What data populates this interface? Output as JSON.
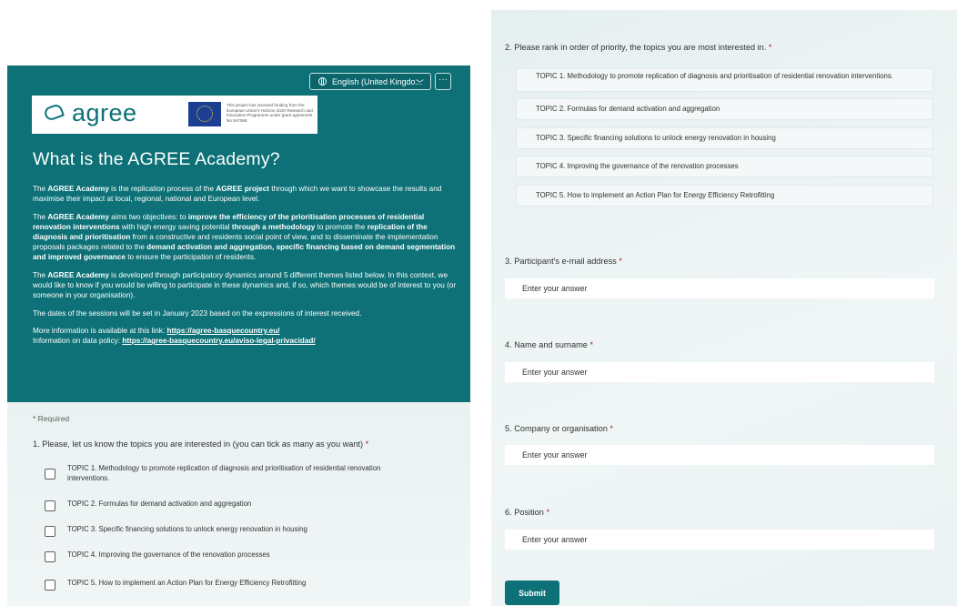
{
  "header": {
    "language_button": "English (United Kingdo...",
    "more_button": "···"
  },
  "logo": {
    "brand": "agree",
    "eu_funding_text": "This project has received funding from the European Union's Horizon 2020 Research and Innovation Programme under grant agreement No 847068."
  },
  "banner": {
    "title": "What is the AGREE Academy?",
    "p1": {
      "t1": "The ",
      "b1": "AGREE Academy",
      "t2": " is the replication process of the ",
      "b2": "AGREE project",
      "t3": " through which we want to showcase the results and maximise their impact at local, regional, national and European level."
    },
    "p2": {
      "t1": "The ",
      "b1": "AGREE Academy",
      "t2": " aims two objectives: to ",
      "b2": "improve the efficiency of the prioritisation processes of residential renovation interventions",
      "t3": " with high energy saving potential ",
      "b3": "through a methodology",
      "t4": " to promote the ",
      "b4": "replication of the diagnosis and prioritisation",
      "t5": " from a constructive and residents social point of view, and to disseminate the implementation proposals packages related to the ",
      "b5": "demand activation and aggregation, specific financing based on demand segmentation and improved governance",
      "t6": " to ensure the participation of residents."
    },
    "p3": {
      "t1": "The ",
      "b1": "AGREE Academy",
      "t2": " is developed through participatory dynamics  around 5 different themes  listed below. In this context, we would like to know if you would be willing to participate in these dynamics and, if so, which themes would be of interest to you (or someone in your organisation)."
    },
    "p4": "The dates of the sessions will be set in January 2023 based on the expressions of interest received.",
    "more_info_label": "More information is available at this link: ",
    "more_info_link": "https://agree-basquecountry.eu/",
    "policy_label": "Information on data policy: ",
    "policy_link": "https://agree-basquecountry.eu/aviso-legal-privacidad/"
  },
  "form": {
    "required_note": "* Required",
    "required_mark": "*",
    "q1": {
      "title": "1. Please, let us know the topics you are interested in (you can tick as many as you want) ",
      "options": [
        "TOPIC 1. Methodology to promote replication of diagnosis and prioritisation of residential renovation interventions.",
        "TOPIC 2. Formulas for demand activation and aggregation",
        "TOPIC 3. Specific financing solutions to unlock energy renovation in housing",
        "TOPIC 4. Improving the governance of the renovation processes",
        "TOPIC 5. How to implement an Action Plan for Energy Efficiency Retrofitting"
      ]
    },
    "q2": {
      "title": "2. Please rank in order of priority, the topics you are most interested in. ",
      "items": [
        "TOPIC 1. Methodology to promote replication of diagnosis and prioritisation of residential renovation interventions.",
        "TOPIC 2. Formulas for demand activation and aggregation",
        "TOPIC 3. Specific financing solutions to unlock energy renovation in housing",
        "TOPIC 4. Improving the governance of the renovation processes",
        "TOPIC 5. How to implement an Action Plan for Energy Efficiency Retrofitting"
      ]
    },
    "q3": {
      "title": "3. Participant's e-mail address ",
      "placeholder": "Enter your answer"
    },
    "q4": {
      "title": "4. Name and surname ",
      "placeholder": "Enter your answer"
    },
    "q5": {
      "title": "5. Company or organisation ",
      "placeholder": "Enter your answer"
    },
    "q6": {
      "title": "6. Position ",
      "placeholder": "Enter your answer"
    },
    "submit_label": "Submit"
  },
  "colors": {
    "banner": "#0d7177",
    "accent": "#0d7177",
    "required": "#a4262c",
    "eu_blue": "#1c3f94",
    "eu_star": "#f9d71c"
  },
  "icons": {
    "language": "globe-icon",
    "dropdown": "chevron-down-icon",
    "more": "more-icon",
    "brand": "agree-logo-icon",
    "funding": "eu-flag-icon"
  }
}
